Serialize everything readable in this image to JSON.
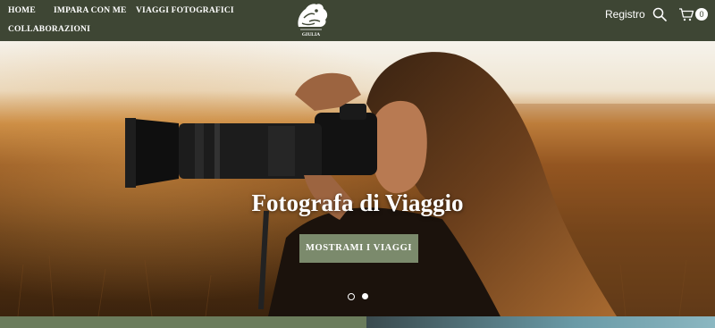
{
  "nav": {
    "home": "HOME",
    "impara": "IMPARA CON ME",
    "viaggi": "VIAGGI FOTOGRAFICI",
    "collaborazioni": "COLLABORAZIONI"
  },
  "logo": {
    "text": "GIULIA"
  },
  "header_right": {
    "registro": "Registro",
    "cart_count": "0"
  },
  "hero": {
    "title": "Fotografa di Viaggio",
    "button": "MOSTRAMI I VIAGGI",
    "slides": 2,
    "active_slide": 2
  },
  "colors": {
    "header": "#3e4634",
    "button": "#7b8a6c"
  }
}
